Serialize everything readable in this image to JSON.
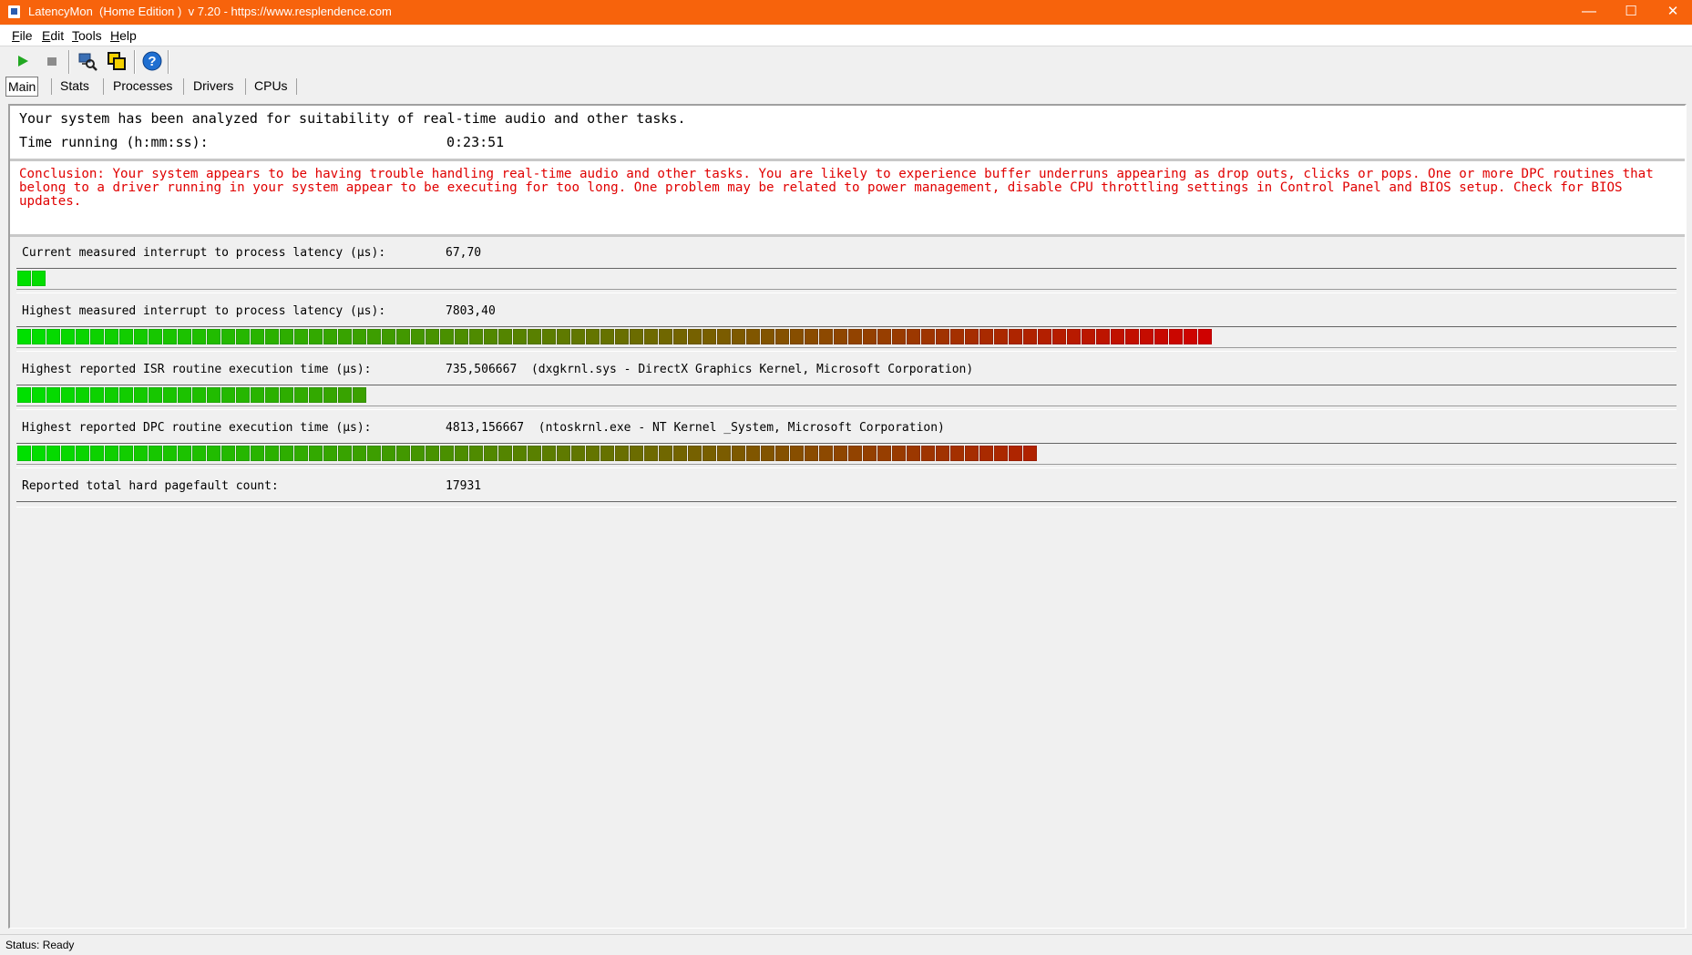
{
  "window": {
    "title": "LatencyMon  (Home Edition )  v 7.20 - https://www.resplendence.com",
    "controls": {
      "minimize": "—",
      "maximize": "☐",
      "close": "✕"
    }
  },
  "menu": [
    {
      "label": "File",
      "accel": "F",
      "rest": "ile"
    },
    {
      "label": "Edit",
      "accel": "E",
      "rest": "dit"
    },
    {
      "label": "Tools",
      "accel": "T",
      "rest": "ools"
    },
    {
      "label": "Help",
      "accel": "H",
      "rest": "elp"
    }
  ],
  "toolbar": {
    "buttons": [
      {
        "name": "start-icon",
        "glyph": "▶",
        "color": "#22a822"
      },
      {
        "name": "stop-icon",
        "glyph": "■",
        "color": "#8c8c8c"
      },
      {
        "name": "system-info-icon",
        "glyph": "🔍",
        "color": "#2a6db0"
      },
      {
        "name": "copy-report-icon",
        "glyph": "❐",
        "color": "#222222"
      },
      {
        "name": "help-icon",
        "glyph": "?",
        "color": "#1f6fd1"
      }
    ]
  },
  "tabs": [
    {
      "label": "Main",
      "active": true
    },
    {
      "label": "Stats",
      "active": false
    },
    {
      "label": "Processes",
      "active": false
    },
    {
      "label": "Drivers",
      "active": false
    },
    {
      "label": "CPUs",
      "active": false
    }
  ],
  "summary": {
    "analyzed_text": "Your system has been analyzed for suitability of real-time audio and other tasks.",
    "time_label": "Time running (h:mm:ss):",
    "time_value": "0:23:51"
  },
  "conclusion": {
    "text": "Conclusion: Your system appears to be having trouble handling real-time audio and other tasks. You are likely to experience buffer underruns appearing as drop outs, clicks or pops. One or more DPC routines that belong to a driver running in your system appear to be executing for too long. One problem may be related to power management, disable CPU throttling settings in Control Panel and BIOS setup. Check for BIOS updates.",
    "color": "#e00000"
  },
  "metrics": [
    {
      "label": "Current measured interrupt to process latency (µs):",
      "value": "67,70",
      "detail": "",
      "level_fraction": 0.016,
      "segments": 2
    },
    {
      "label": "Highest measured interrupt to process latency (µs):",
      "value": "7803,40",
      "detail": "",
      "level_fraction": 0.72,
      "segments": 82
    },
    {
      "label": "Highest reported ISR routine execution time (µs):",
      "value": "735,506667",
      "detail": "(dxgkrnl.sys - DirectX Graphics Kernel, Microsoft Corporation)",
      "level_fraction": 0.21,
      "segments": 24
    },
    {
      "label": "Highest reported DPC routine execution time (µs):",
      "value": "4813,156667",
      "detail": "(ntoskrnl.exe - NT Kernel _System, Microsoft Corporation)",
      "level_fraction": 0.615,
      "segments": 70
    },
    {
      "label": "Reported total hard pagefault count:",
      "value": "17931",
      "detail": ""
    }
  ],
  "bar_colors": {
    "low": "#00e000",
    "high": "#d00000"
  },
  "status": {
    "text": "Status: Ready"
  }
}
